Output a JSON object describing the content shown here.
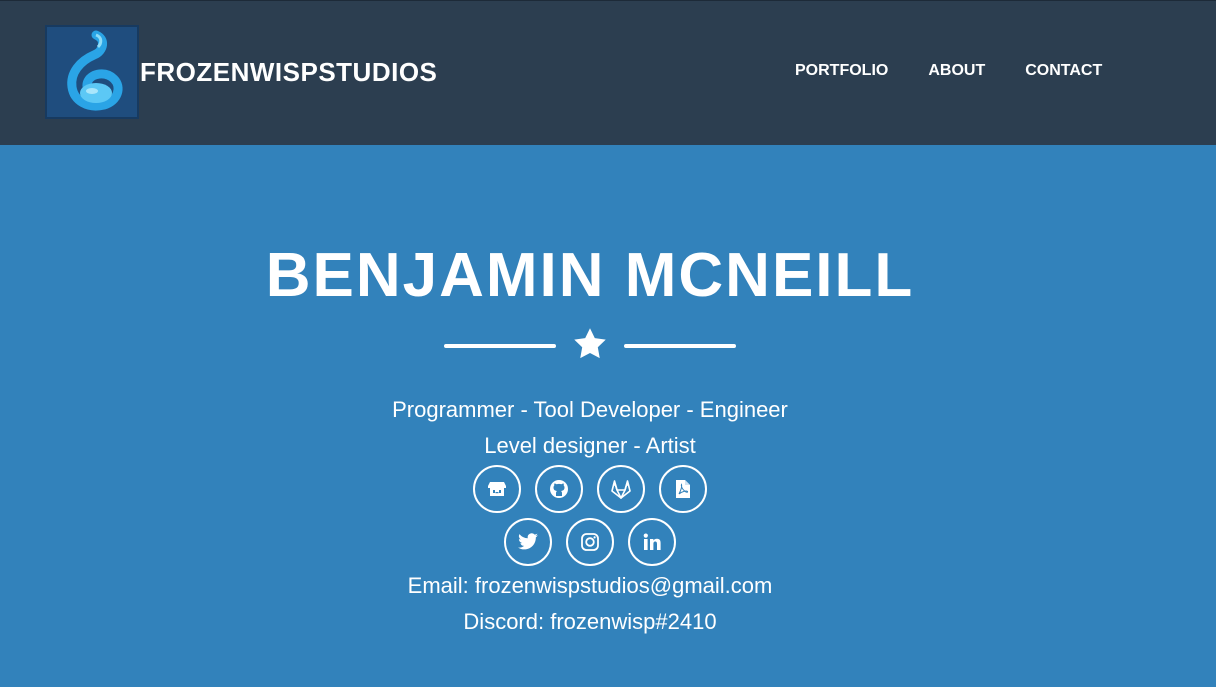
{
  "header": {
    "brand": "FROZENWISPSTUDIOS",
    "nav": [
      {
        "label": "PORTFOLIO"
      },
      {
        "label": "ABOUT"
      },
      {
        "label": "CONTACT"
      }
    ]
  },
  "hero": {
    "name": "BENJAMIN MCNEILL",
    "divider_icon": "star-icon",
    "roles_line1": "Programmer - Tool Developer - Engineer",
    "roles_line2": "Level designer - Artist",
    "social_row1": [
      "itch-io-icon",
      "github-icon",
      "gitlab-icon",
      "pdf-icon"
    ],
    "social_row2": [
      "twitter-icon",
      "instagram-icon",
      "linkedin-icon"
    ],
    "email": "Email: frozenwispstudios@gmail.com",
    "discord": "Discord: frozenwisp#2410"
  },
  "colors": {
    "navbar": "#2c3e50",
    "hero": "#3282bb",
    "text": "#ffffff"
  }
}
